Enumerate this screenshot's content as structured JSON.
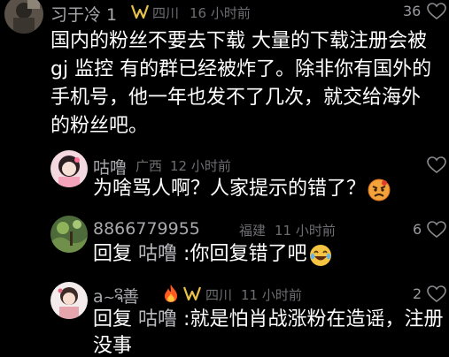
{
  "comments": [
    {
      "username": "习于冷 1",
      "location": "四川",
      "time": "16 小时前",
      "likes": "36",
      "text_lines": [
        "国内的粉丝不要去下载 大量的下载注册会被",
        "gj 监控 有的群已经被炸了。除非你有国外的",
        "手机号，他一年也发不了几次，就交给海外",
        "的粉丝吧。"
      ]
    },
    {
      "username": "咕噜",
      "location": "广西",
      "time": "12 小时前",
      "likes": "",
      "text": "为啥骂人啊？人家提示的错了？"
    },
    {
      "username": "8866779955",
      "location": "福建",
      "time": "11 小时前",
      "likes": "6",
      "reply_word": "回复",
      "reply_to": "咕噜",
      "text": ":你回复错了吧"
    },
    {
      "username": "a",
      "username_suffix": "善",
      "location": "四川",
      "time": "11 小时前",
      "likes": "2",
      "reply_word": "回复",
      "reply_to": "咕噜",
      "text_line1": ":就是怕肖战涨粉在造谣，注册",
      "text_line2": "没事"
    }
  ],
  "colors": {
    "background": "#000000",
    "username": "#a9a9ad",
    "meta": "#6d6d72",
    "badge": "#e8c24a",
    "fire": "#ff5a1f"
  },
  "icons": [
    "avatar",
    "badge-icon",
    "heart-icon",
    "more-icon",
    "angry-emoji",
    "laugh-emoji",
    "fire-emoji"
  ]
}
